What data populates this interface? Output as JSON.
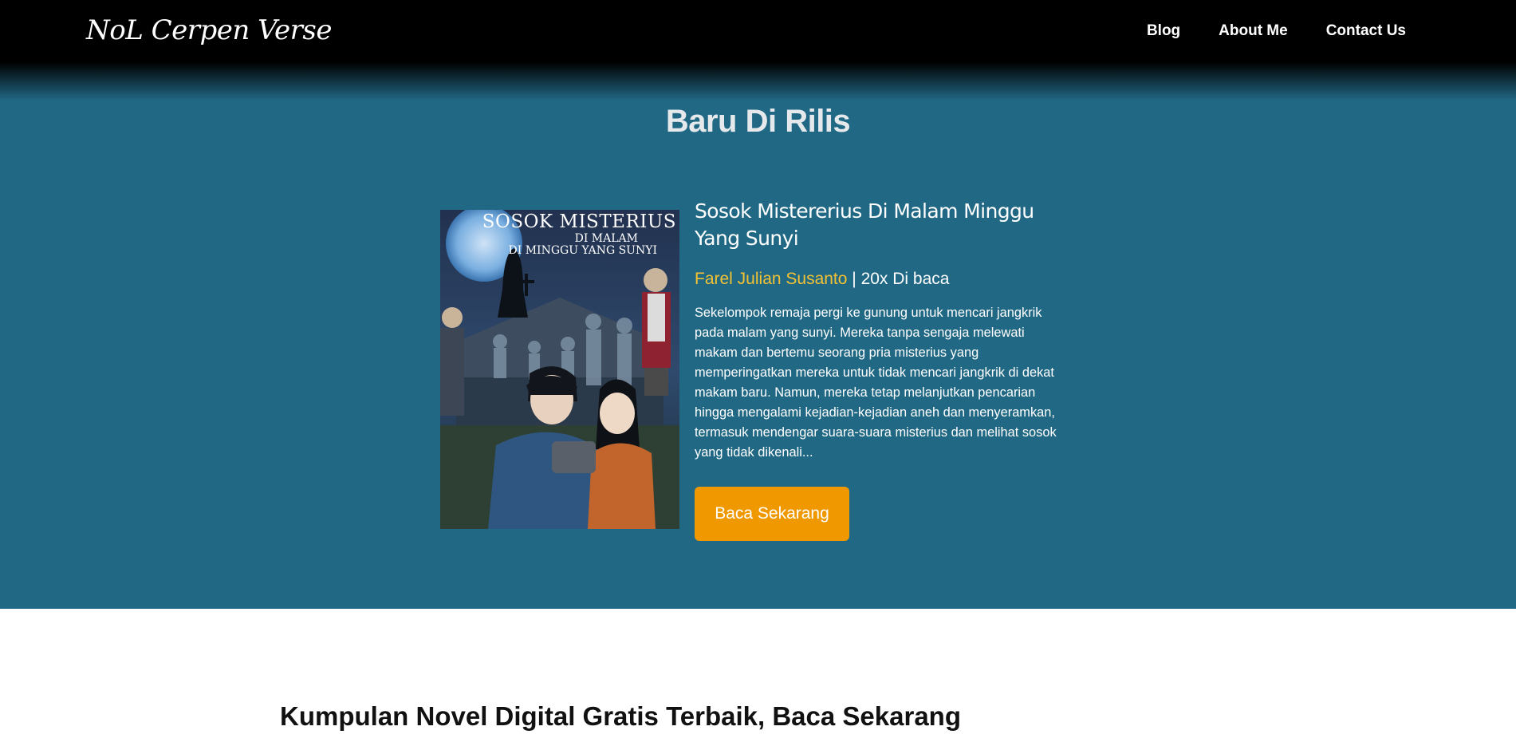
{
  "header": {
    "logo": "NoL Cerpen Verse",
    "nav": [
      {
        "label": "Blog"
      },
      {
        "label": "About Me"
      },
      {
        "label": "Contact Us"
      }
    ]
  },
  "featured": {
    "section_title": "Baru Di Rilis",
    "cover": {
      "title_line1": "SOSOK MISTERIUS",
      "title_line2": "DI MALAM",
      "title_line3": "DI MINGGU YANG SUNYI"
    },
    "book_title": "Sosok Mistererius Di Malam Minggu Yang Sunyi",
    "author": "Farel Julian Susanto",
    "reads": " | 20x Di baca",
    "synopsis": "Sekelompok remaja pergi ke gunung untuk mencari jangkrik pada malam yang sunyi. Mereka tanpa sengaja melewati makam dan bertemu seorang pria misterius yang memperingatkan mereka untuk tidak mencari jangkrik di dekat makam baru. Namun, mereka tetap melanjutkan pencarian hingga mengalami kejadian-kejadian aneh dan menyeramkan, termasuk mendengar suara-suara misterius dan melihat sosok yang tidak dikenali...",
    "button_label": "Baca Sekarang"
  },
  "collection": {
    "heading": "Kumpulan Novel Digital Gratis Terbaik, Baca Sekarang"
  },
  "colors": {
    "navbar": "#000000",
    "hero_bg": "#216885",
    "author": "#f2c233",
    "button": "#ef9800"
  }
}
